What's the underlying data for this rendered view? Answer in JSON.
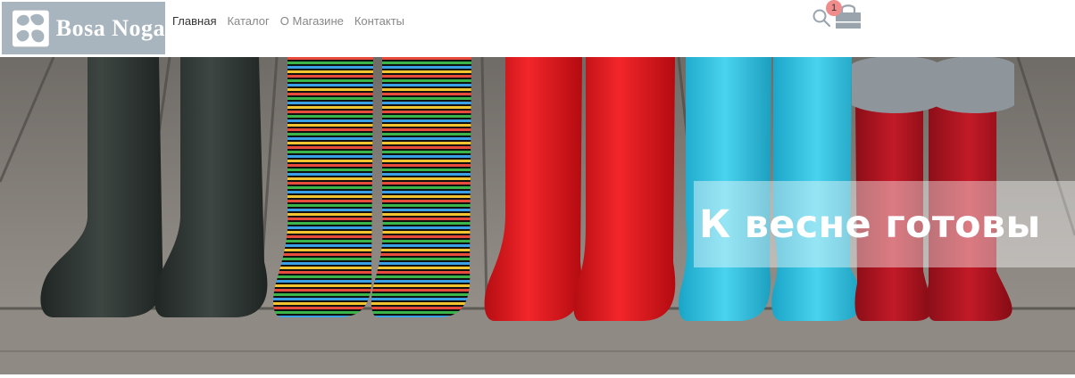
{
  "logo": {
    "text": "Bosa Noga",
    "background": "#a8b4be"
  },
  "nav": {
    "items": [
      {
        "label": "Главная",
        "active": true
      },
      {
        "label": "Каталог",
        "active": false
      },
      {
        "label": "О Магазине",
        "active": false
      },
      {
        "label": "Контакты",
        "active": false
      }
    ]
  },
  "header_actions": {
    "search_icon": "search-icon",
    "cart_icon": "shopping-bag-icon",
    "cart_count": "1",
    "badge_color": "#f08c8c"
  },
  "hero": {
    "title": "К весне готовы",
    "image": "rain-boots-photo"
  }
}
